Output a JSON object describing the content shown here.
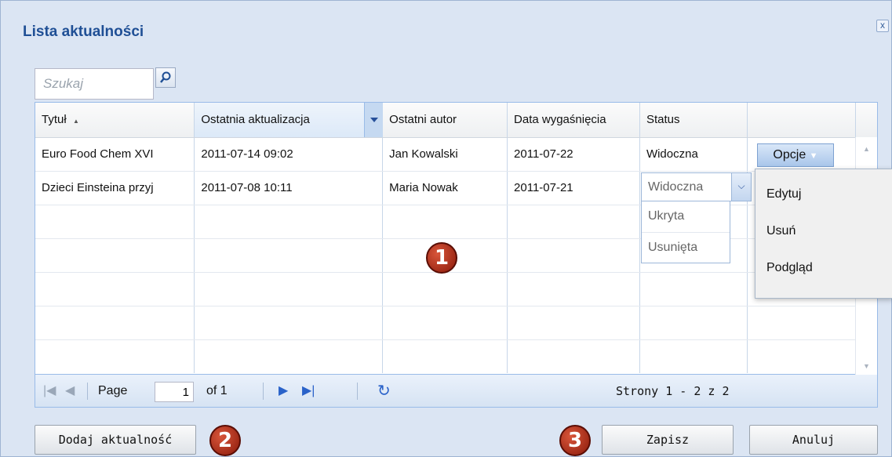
{
  "dialog": {
    "title": "Lista aktualności",
    "close_label": "x"
  },
  "search": {
    "placeholder": "Szukaj"
  },
  "grid": {
    "columns": [
      "Tytuł",
      "Ostatnia aktualizacja",
      "Ostatni autor",
      "Data wygaśnięcia",
      "Status",
      ""
    ],
    "sort_indicator": "▲",
    "rows": [
      {
        "title": "Euro Food Chem XVI",
        "updated": "2011-07-14 09:02",
        "author": "Jan Kowalski",
        "expires": "2011-07-22",
        "status": "Widoczna"
      },
      {
        "title": "Dzieci Einsteina przyj",
        "updated": "2011-07-08 10:11",
        "author": "Maria Nowak",
        "expires": "2011-07-21",
        "status": "Widoczna"
      }
    ],
    "options_button": "Opcje",
    "status_options": [
      "Ukryta",
      "Usunięta"
    ],
    "options_menu": [
      "Edytuj",
      "Usuń",
      "Podgląd"
    ]
  },
  "pager": {
    "page_label": "Page",
    "page_value": "1",
    "of_label": "of 1",
    "summary": "Strony 1 - 2 z 2"
  },
  "buttons": {
    "add": "Dodaj aktualność",
    "save": "Zapisz",
    "cancel": "Anuluj"
  },
  "markers": [
    "1",
    "2",
    "3"
  ]
}
